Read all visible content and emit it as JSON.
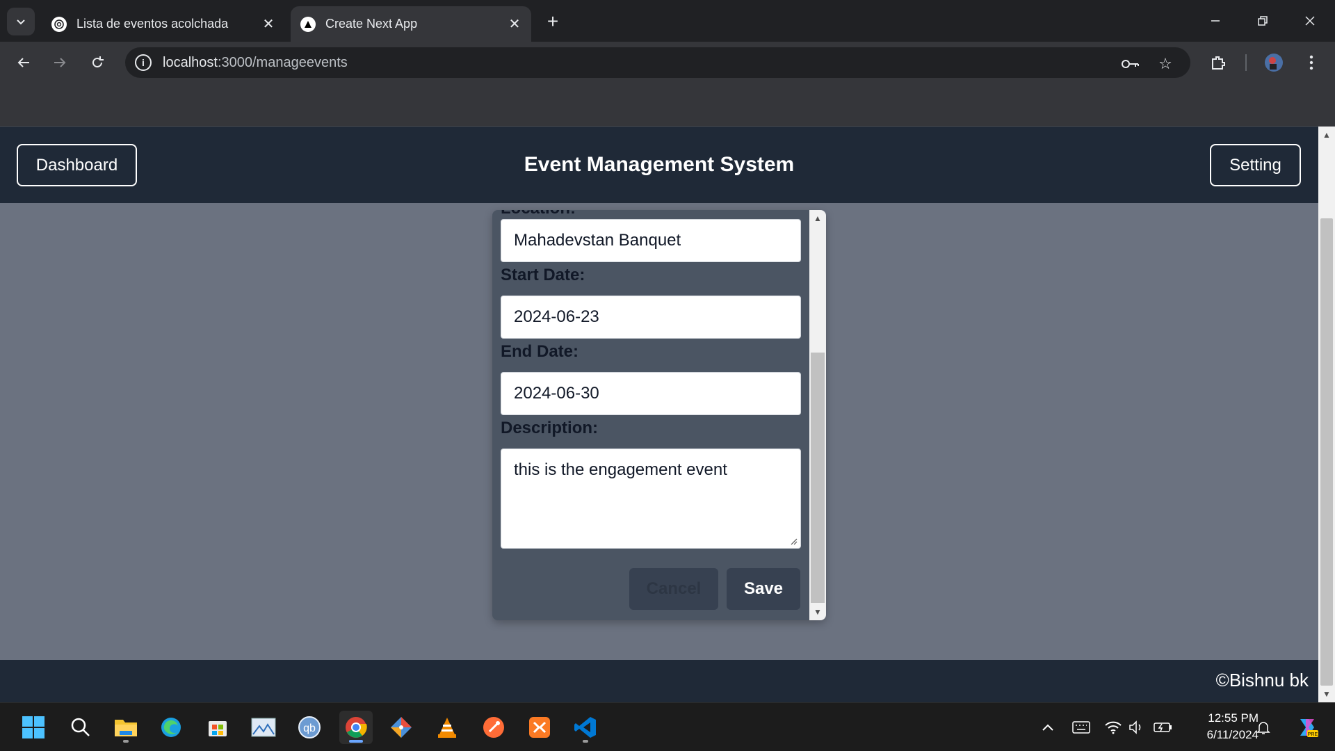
{
  "browser": {
    "tabs": [
      {
        "title": "Lista de eventos acolchada",
        "active": false
      },
      {
        "title": "Create Next App",
        "active": true
      }
    ],
    "url_host": "localhost",
    "url_path": ":3000/manageevents"
  },
  "header": {
    "dashboard_label": "Dashboard",
    "title": "Event Management System",
    "setting_label": "Setting"
  },
  "form": {
    "location_label": "Location:",
    "location_value": "Mahadevstan Banquet",
    "start_date_label": "Start Date:",
    "start_date_value": "2024-06-23",
    "end_date_label": "End Date:",
    "end_date_value": "2024-06-30",
    "description_label": "Description:",
    "description_value": "this is the engagement event",
    "cancel_label": "Cancel",
    "save_label": "Save"
  },
  "footer": {
    "text": "©Bishnu bk"
  },
  "taskbar": {
    "time": "12:55 PM",
    "date": "6/11/2024"
  },
  "colors": {
    "header_bg": "#1f2937",
    "page_bg": "#6b7280",
    "modal_bg": "#4b5563",
    "button_bg": "#374151"
  }
}
